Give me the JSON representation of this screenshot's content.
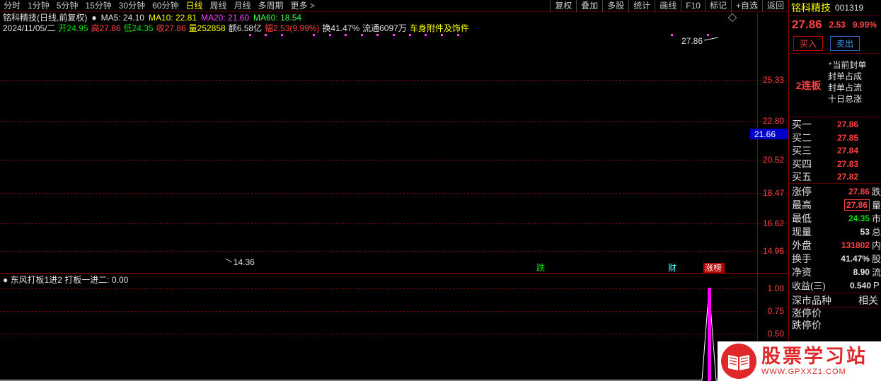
{
  "toolbar": {
    "periods": [
      "分时",
      "1分钟",
      "5分钟",
      "15分钟",
      "30分钟",
      "60分钟",
      "日线",
      "周线",
      "月线",
      "多周期",
      "更多 >"
    ],
    "active_period": "日线",
    "tools": [
      "复权",
      "叠加",
      "多股",
      "统计",
      "画线",
      "F10",
      "标记",
      "+自选",
      "返回"
    ]
  },
  "chart_header": {
    "title": "铭科精技(日线,前复权)",
    "ma5": "MA5: 24.10",
    "ma10": "MA10: 22.81",
    "ma20": "MA20: 21.60",
    "ma60": "MA60: 18.54"
  },
  "ohlc": {
    "date": "2024/11/05/二",
    "open": "开24.95",
    "high": "高27.86",
    "low": "低24.35",
    "close": "收27.86",
    "volume": "量252858",
    "amount": "额6.58亿",
    "range": "幅2.53(9.99%)",
    "turnover": "换41.47%",
    "float": "流通6097万",
    "sector": "车身附件及饰件"
  },
  "price_axis": {
    "labels": [
      "25.33",
      "22.80",
      "20.52",
      "18.47",
      "16.62",
      "14.96"
    ],
    "current": "21.66"
  },
  "annotations": {
    "high": "27.86",
    "low": "14.36",
    "event_markers": [
      "跌",
      "财",
      "涨榜"
    ]
  },
  "indicator": {
    "header": "东风打板1进2",
    "value": "打板一进二: 0.00",
    "axis": [
      "1.00",
      "0.75",
      "0.50"
    ]
  },
  "panel": {
    "name": "铭科精技",
    "code": "001319",
    "last": "27.86",
    "change": "2.53",
    "pct": "9.99%",
    "buy_label": "买入",
    "sell_label": "卖出",
    "streak": "2连板",
    "seal_items": [
      "当前封单",
      "封单占成",
      "封单占流",
      "十日总涨"
    ],
    "book": [
      {
        "label": "买一",
        "price": "27.86"
      },
      {
        "label": "买二",
        "price": "27.85"
      },
      {
        "label": "买三",
        "price": "27.84"
      },
      {
        "label": "买四",
        "price": "27.83"
      },
      {
        "label": "买五",
        "price": "27.82"
      }
    ],
    "stats": [
      {
        "label": "涨停",
        "value": "27.86",
        "extra": "跌",
        "color": "#ff4040",
        "boxed": false
      },
      {
        "label": "最高",
        "value": "27.86",
        "extra": "量",
        "color": "#ff4040",
        "boxed": true
      },
      {
        "label": "最低",
        "value": "24.35",
        "extra": "市",
        "color": "#00e000",
        "boxed": false
      },
      {
        "label": "现量",
        "value": "53",
        "extra": "总",
        "color": "#e0e0e0",
        "boxed": false
      },
      {
        "label": "外盘",
        "value": "131802",
        "extra": "内",
        "color": "#ff4040",
        "boxed": false
      },
      {
        "label": "换手",
        "value": "41.47%",
        "extra": "股",
        "color": "#e0e0e0",
        "boxed": false
      },
      {
        "label": "净资",
        "value": "8.90",
        "extra": "流",
        "color": "#e0e0e0",
        "boxed": false
      },
      {
        "label": "收益(三)",
        "value": "0.540",
        "extra": "P",
        "color": "#e0e0e0",
        "boxed": false
      }
    ],
    "tabs": [
      "深市品种",
      "相关"
    ],
    "limits": [
      "涨停价",
      "跌停价"
    ]
  },
  "watermark": {
    "text": "股票学习站",
    "url": "WWW.GPXXZ1.COM"
  },
  "colors": {
    "up": "#ff3232",
    "down": "#54ffff",
    "ma5": "#ffffff",
    "ma10": "#ffff00",
    "ma20": "#ff40ff",
    "ma60": "#00dd00",
    "grid": "#8b0000"
  }
}
